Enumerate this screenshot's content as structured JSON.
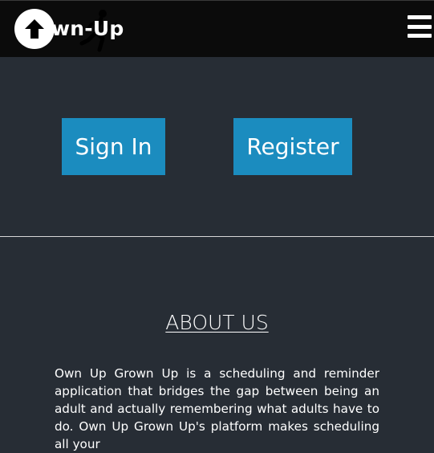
{
  "navbar": {
    "brand": "wn-Up",
    "scroll_up_icon": "arrow-up-icon",
    "menu_icon": "hamburger-menu-icon",
    "brand_icon": "running-figure-icon"
  },
  "hero": {
    "sign_in_label": "Sign In",
    "register_label": "Register"
  },
  "about": {
    "title": "ABOUT US",
    "body": "Own Up Grown Up is a scheduling and reminder application that bridges the gap between being an adult and actually remembering what adults have to do. Own Up Grown Up's platform makes scheduling all your"
  },
  "colors": {
    "navbar_bg": "#0b0b0b",
    "page_bg": "#272d35",
    "button_bg": "#1b8cbf",
    "text": "#ffffff"
  }
}
